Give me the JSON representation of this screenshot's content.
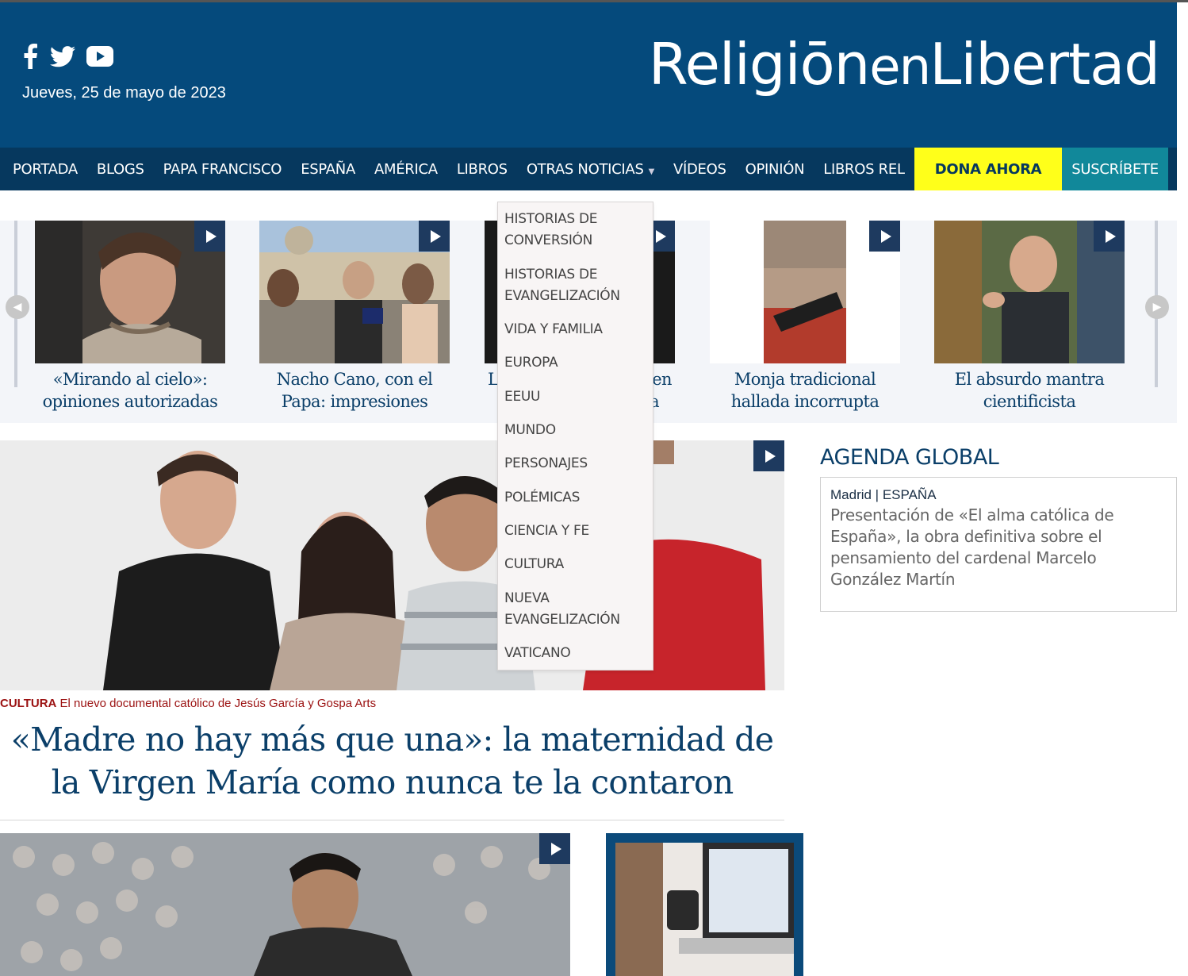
{
  "header": {
    "date": "Jueves, 25 de mayo de 2023",
    "logo_part1": "Religiōn",
    "logo_part2": "en",
    "logo_part3": "Libertad",
    "social_icons": [
      "facebook-icon",
      "twitter-icon",
      "youtube-icon"
    ]
  },
  "nav": {
    "items": [
      "PORTADA",
      "BLOGS",
      "PAPA FRANCISCO",
      "ESPAÑA",
      "AMÉRICA",
      "LIBROS",
      "OTRAS NOTICIAS",
      "VÍDEOS",
      "OPINIÓN",
      "LIBROS REL"
    ],
    "dona": "DONA AHORA",
    "suscribete": "SUSCRÍBETE",
    "search_icon": "search-icon"
  },
  "dropdown": {
    "items": [
      "HISTORIAS DE CONVERSIÓN",
      "HISTORIAS DE EVANGELIZACIÓN",
      "VIDA Y FAMILIA",
      "EUROPA",
      "EEUU",
      "MUNDO",
      "PERSONAJES",
      "POLÉMICAS",
      "CIENCIA Y FE",
      "CULTURA",
      "NUEVA EVANGELIZACIÓN",
      "VATICANO"
    ]
  },
  "carousel": {
    "slides": [
      {
        "caption": "«Mirando al cielo»: opiniones autorizadas"
      },
      {
        "caption": "Nacho Cano, con el Papa: impresiones"
      },
      {
        "caption_left": "L",
        "caption_right": "en",
        "caption_right2": "a"
      },
      {
        "caption": "Monja tradicional hallada incorrupta"
      },
      {
        "caption": "El absurdo mantra cientificista"
      }
    ]
  },
  "hero": {
    "category": "CULTURA",
    "subtitle": "El nuevo documental católico de Jesús García y Gospa Arts",
    "title": "«Madre no hay más que una»: la maternidad de la Virgen María como nunca te la contaron"
  },
  "agenda": {
    "heading": "AGENDA GLOBAL",
    "location": "Madrid | ESPAÑA",
    "text": "Presentación de «El alma católica de España», la obra definitiva sobre el pensamiento del cardenal Marcelo González Martín"
  },
  "colors": {
    "header_blue": "#054a7c",
    "nav_blue": "#06385e",
    "dona_yellow": "#ffff1a",
    "suscribete_teal": "#11889a",
    "title_blue": "#0b3f69",
    "category_red": "#9b1111"
  }
}
